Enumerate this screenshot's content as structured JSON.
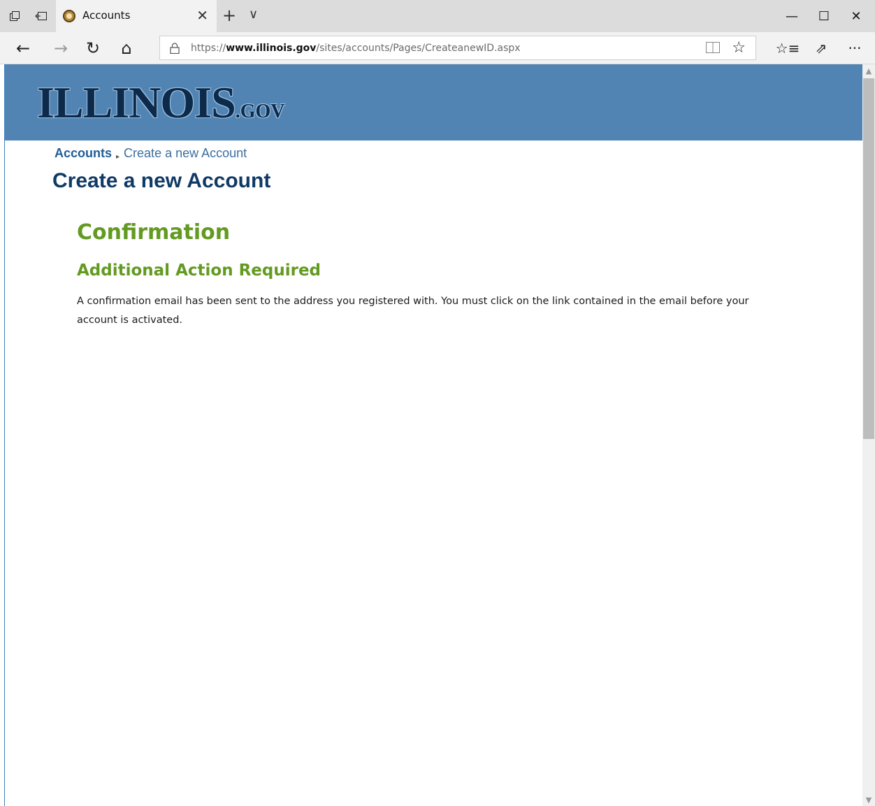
{
  "browser": {
    "tab_title": "Accounts",
    "tab_close": "✕",
    "new_tab": "+",
    "tab_list": "∨",
    "icons": {
      "tab_preview": "tabs-aside-icon",
      "set_aside": "set-aside-icon",
      "favicon": "illinois-seal-icon"
    },
    "window": {
      "minimize": "—",
      "maximize": "☐",
      "close": "✕"
    },
    "nav": {
      "back": "←",
      "forward": "→",
      "refresh": "↻",
      "home": "⌂"
    },
    "address": {
      "scheme": "https://",
      "domain": "www.illinois.gov",
      "path": "/sites/accounts/Pages/CreateanewID.aspx"
    },
    "tools": {
      "reading_view": "📖",
      "favorite": "☆",
      "favorites_list": "☆≡",
      "share": "⇗",
      "more": "···"
    }
  },
  "site": {
    "logo_main": "ILLINOIS",
    "logo_suffix": ".GOV",
    "header_color": "#5284b3"
  },
  "breadcrumb": {
    "root": "Accounts",
    "separator": "▸",
    "current": "Create a new Account"
  },
  "page": {
    "title": "Create a new Account",
    "confirmation_heading": "Confirmation",
    "action_heading": "Additional Action Required",
    "message": "A confirmation email has been sent to the address you registered with. You must click on the link contained in the email before your account is activated."
  },
  "scrollbar": {
    "up": "▲",
    "down": "▼"
  },
  "colors": {
    "heading_green": "#639a22",
    "title_blue": "#103a66",
    "link_blue": "#1f5e96"
  }
}
